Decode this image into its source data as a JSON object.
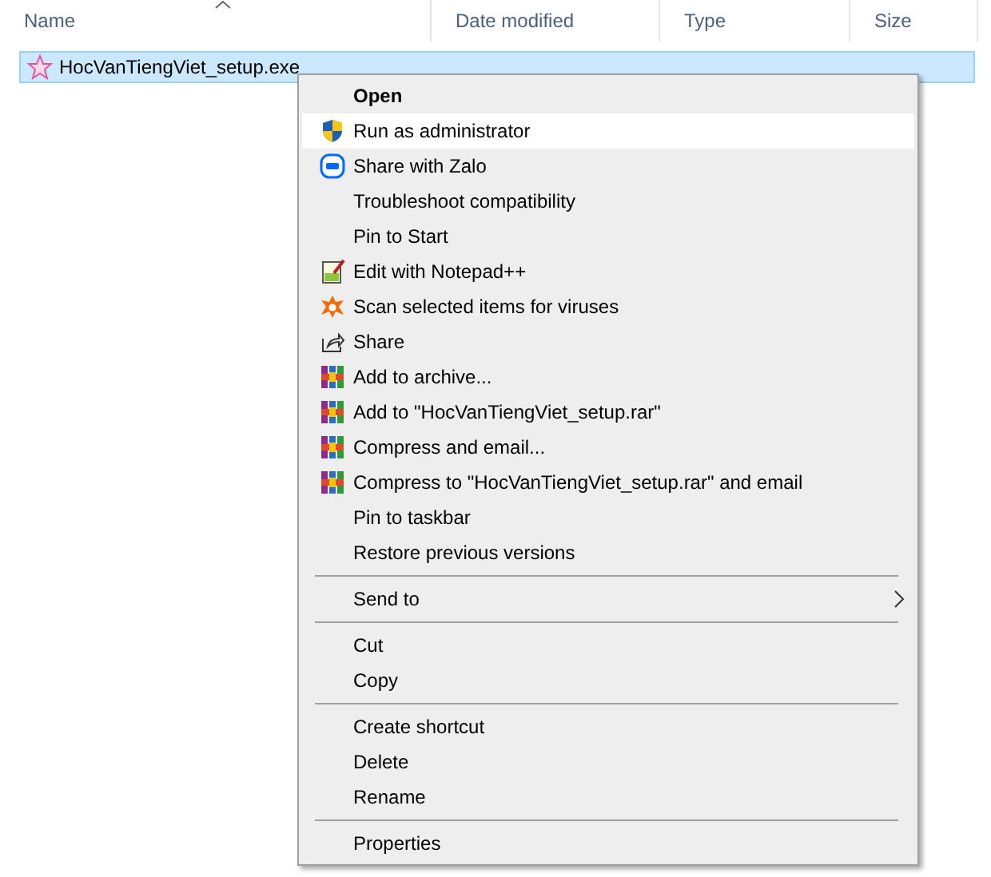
{
  "columns": [
    {
      "label": "Name",
      "sorted": true
    },
    {
      "label": "Date modified",
      "sorted": false
    },
    {
      "label": "Type",
      "sorted": false
    },
    {
      "label": "Size",
      "sorted": false
    }
  ],
  "file": {
    "name": "HocVanTiengViet_setup.exe",
    "selected": true
  },
  "menu": [
    {
      "kind": "item",
      "label": "Open",
      "default": true,
      "highlighted": false,
      "submenu": false
    },
    {
      "kind": "item",
      "label": "Run as administrator",
      "default": false,
      "highlighted": true,
      "submenu": false
    },
    {
      "kind": "item",
      "label": "Share with Zalo",
      "default": false,
      "highlighted": false,
      "submenu": false
    },
    {
      "kind": "item",
      "label": "Troubleshoot compatibility",
      "default": false,
      "highlighted": false,
      "submenu": false
    },
    {
      "kind": "item",
      "label": "Pin to Start",
      "default": false,
      "highlighted": false,
      "submenu": false
    },
    {
      "kind": "item",
      "label": "Edit with Notepad++",
      "default": false,
      "highlighted": false,
      "submenu": false
    },
    {
      "kind": "item",
      "label": "Scan selected items for viruses",
      "default": false,
      "highlighted": false,
      "submenu": false
    },
    {
      "kind": "item",
      "label": "Share",
      "default": false,
      "highlighted": false,
      "submenu": false
    },
    {
      "kind": "item",
      "label": "Add to archive...",
      "default": false,
      "highlighted": false,
      "submenu": false
    },
    {
      "kind": "item",
      "label": "Add to \"HocVanTiengViet_setup.rar\"",
      "default": false,
      "highlighted": false,
      "submenu": false
    },
    {
      "kind": "item",
      "label": "Compress and email...",
      "default": false,
      "highlighted": false,
      "submenu": false
    },
    {
      "kind": "item",
      "label": "Compress to \"HocVanTiengViet_setup.rar\" and email",
      "default": false,
      "highlighted": false,
      "submenu": false
    },
    {
      "kind": "item",
      "label": "Pin to taskbar",
      "default": false,
      "highlighted": false,
      "submenu": false
    },
    {
      "kind": "item",
      "label": "Restore previous versions",
      "default": false,
      "highlighted": false,
      "submenu": false
    },
    {
      "kind": "separator"
    },
    {
      "kind": "item",
      "label": "Send to",
      "default": false,
      "highlighted": false,
      "submenu": true
    },
    {
      "kind": "separator"
    },
    {
      "kind": "item",
      "label": "Cut",
      "default": false,
      "highlighted": false,
      "submenu": false
    },
    {
      "kind": "item",
      "label": "Copy",
      "default": false,
      "highlighted": false,
      "submenu": false
    },
    {
      "kind": "separator"
    },
    {
      "kind": "item",
      "label": "Create shortcut",
      "default": false,
      "highlighted": false,
      "submenu": false
    },
    {
      "kind": "item",
      "label": "Delete",
      "default": false,
      "highlighted": false,
      "submenu": false
    },
    {
      "kind": "item",
      "label": "Rename",
      "default": false,
      "highlighted": false,
      "submenu": false
    },
    {
      "kind": "separator"
    },
    {
      "kind": "item",
      "label": "Properties",
      "default": false,
      "highlighted": false,
      "submenu": false
    }
  ]
}
